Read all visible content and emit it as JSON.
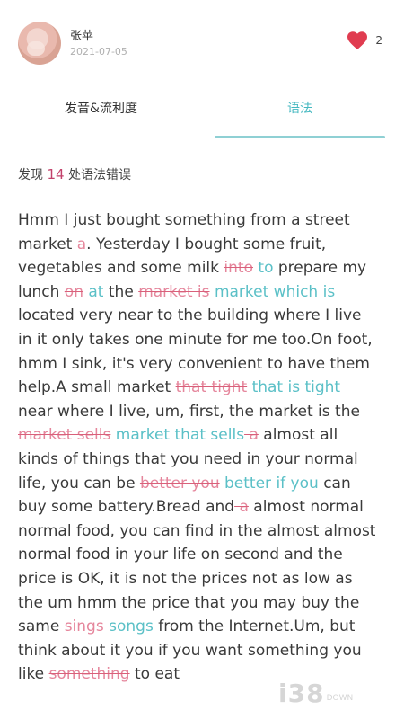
{
  "user": {
    "name": "张苹",
    "date": "2021-07-05"
  },
  "likes": {
    "count": "2",
    "icon": "heart-icon",
    "color": "#e03c50"
  },
  "tabs": [
    {
      "label": "发音&流利度",
      "active": false
    },
    {
      "label": "语法",
      "active": true
    }
  ],
  "summary": {
    "prefix": "发现",
    "count": "14",
    "suffix": "处语法错误"
  },
  "segments": [
    {
      "t": "Hmm I just bought something from a street market",
      "k": "n"
    },
    {
      "t": " a",
      "k": "d"
    },
    {
      "t": ". Yesterday I bought some fruit, vegetables and some milk ",
      "k": "n"
    },
    {
      "t": "into",
      "k": "d"
    },
    {
      "t": " ",
      "k": "n"
    },
    {
      "t": "to",
      "k": "i"
    },
    {
      "t": " prepare my lunch ",
      "k": "n"
    },
    {
      "t": "on",
      "k": "d"
    },
    {
      "t": " ",
      "k": "n"
    },
    {
      "t": "at",
      "k": "i"
    },
    {
      "t": " the ",
      "k": "n"
    },
    {
      "t": "market is",
      "k": "d"
    },
    {
      "t": " ",
      "k": "n"
    },
    {
      "t": "market which is",
      "k": "i"
    },
    {
      "t": " located very near to the building where I live in it only takes one minute for me too.On foot, hmm I sink, it's very convenient to have them help.A small market ",
      "k": "n"
    },
    {
      "t": "that tight",
      "k": "d"
    },
    {
      "t": " ",
      "k": "n"
    },
    {
      "t": "that is tight",
      "k": "i"
    },
    {
      "t": " near where I live, um, first, the market is the ",
      "k": "n"
    },
    {
      "t": "market sells",
      "k": "d"
    },
    {
      "t": " ",
      "k": "n"
    },
    {
      "t": "market that sells",
      "k": "i"
    },
    {
      "t": " a",
      "k": "d"
    },
    {
      "t": " almost all kinds of things that you need in your normal life, you can be ",
      "k": "n"
    },
    {
      "t": "better you",
      "k": "d"
    },
    {
      "t": " ",
      "k": "n"
    },
    {
      "t": "better if you",
      "k": "i"
    },
    {
      "t": " can buy some battery.Bread and",
      "k": "n"
    },
    {
      "t": " a",
      "k": "d"
    },
    {
      "t": " almost normal normal food, you can find in the almost almost normal food in your life on second and the price is OK, it is not the prices not as low as the um hmm the price that you may buy the same ",
      "k": "n"
    },
    {
      "t": "sings",
      "k": "d"
    },
    {
      "t": " ",
      "k": "n"
    },
    {
      "t": "songs",
      "k": "i"
    },
    {
      "t": " from the Internet.Um, but think about it you if you want something you like ",
      "k": "n"
    },
    {
      "t": "something",
      "k": "d"
    },
    {
      "t": " to eat",
      "k": "n"
    }
  ],
  "watermark": {
    "big": "i38",
    "small": "DOWN"
  }
}
